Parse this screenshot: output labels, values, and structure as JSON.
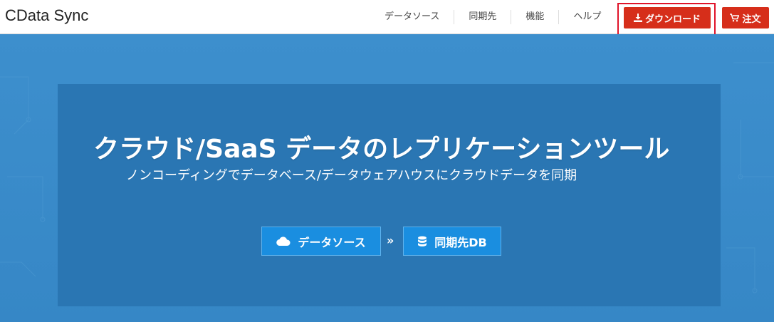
{
  "header": {
    "logo": "CData Sync",
    "nav": [
      {
        "label": "データソース"
      },
      {
        "label": "同期先"
      },
      {
        "label": "機能"
      },
      {
        "label": "ヘルプ"
      }
    ],
    "download_label": "ダウンロード",
    "order_label": "注文"
  },
  "hero": {
    "title": "クラウド/SaaS データのレプリケーションツール",
    "subtitle": "ノンコーディングでデータベース/データウェアハウスにクラウドデータを同期",
    "source_button": "データソース",
    "separator": "»",
    "dest_button": "同期先DB"
  },
  "icons": {
    "download": "download-icon",
    "cart": "cart-icon",
    "cloud": "cloud-icon",
    "database": "database-icon"
  },
  "colors": {
    "accent_red": "#d62e1a",
    "hero_blue": "#3a8bc9",
    "panel_blue": "#2a76b3",
    "cta_blue": "#1a8ee0",
    "highlight": "#e0142a"
  }
}
